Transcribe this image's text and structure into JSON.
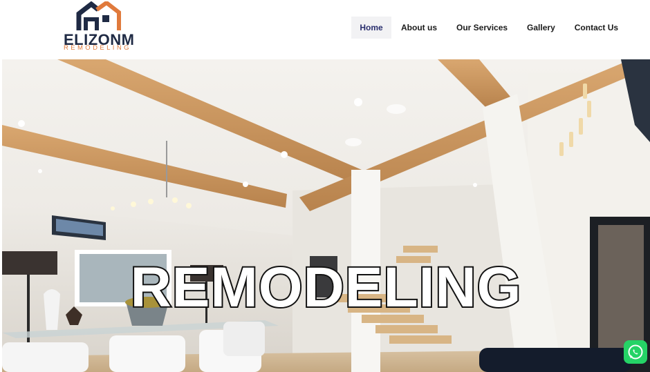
{
  "brand": {
    "name": "ELIZONM",
    "tagline": "REMODELING",
    "colors": {
      "navy": "#1f2a44",
      "orange": "#e07a3c"
    }
  },
  "nav": {
    "items": [
      {
        "label": "Home",
        "active": true
      },
      {
        "label": "About us",
        "active": false
      },
      {
        "label": "Our Services",
        "active": false
      },
      {
        "label": "Gallery",
        "active": false
      },
      {
        "label": "Contact Us",
        "active": false
      }
    ],
    "active_color": "#2a2f6e"
  },
  "hero": {
    "title": "REMODELING"
  },
  "widgets": {
    "chat_icon": "whatsapp-icon",
    "chat_color": "#25d366"
  }
}
